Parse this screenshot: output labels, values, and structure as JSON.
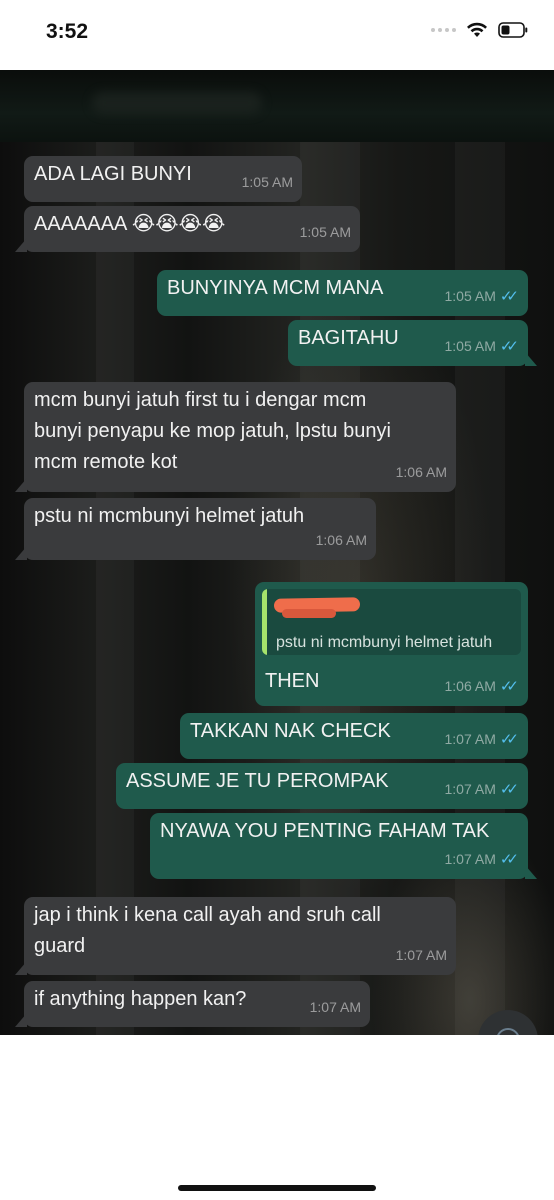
{
  "status_bar": {
    "time": "3:52"
  },
  "messages": [
    {
      "dir": "in",
      "text": "ADA LAGI BUNYI",
      "time": "1:05 AM"
    },
    {
      "dir": "in",
      "text": "AAAAAAA 😭😭😭😭",
      "time": "1:05 AM"
    },
    {
      "dir": "out",
      "text": "BUNYINYA MCM MANA",
      "time": "1:05 AM",
      "read": true
    },
    {
      "dir": "out",
      "text": "BAGITAHU",
      "time": "1:05 AM",
      "read": true
    },
    {
      "dir": "in",
      "text": "mcm bunyi jatuh first tu i dengar mcm\nbunyi penyapu ke mop jatuh, lpstu bunyi\nmcm remote kot",
      "time": "1:06 AM"
    },
    {
      "dir": "in",
      "text": "pstu ni mcmbunyi helmet jatuh",
      "time": "1:06 AM"
    },
    {
      "dir": "out",
      "text": "THEN",
      "time": "1:06 AM",
      "read": true,
      "reply_to": "pstu ni mcmbunyi helmet jatuh"
    },
    {
      "dir": "out",
      "text": "TAKKAN NAK CHECK",
      "time": "1:07 AM",
      "read": true
    },
    {
      "dir": "out",
      "text": "ASSUME JE TU PEROMPAK",
      "time": "1:07 AM",
      "read": true
    },
    {
      "dir": "out",
      "text": "NYAWA YOU PENTING FAHAM TAK",
      "time": "1:07 AM",
      "read": true
    },
    {
      "dir": "in",
      "text": "jap i think i kena call ayah and sruh call\nguard",
      "time": "1:07 AM"
    },
    {
      "dir": "in",
      "text": "if anything happen kan?",
      "time": "1:07 AM"
    }
  ],
  "icons": {
    "signal": "signal-dots-icon",
    "wifi": "wifi-icon",
    "battery": "battery-icon",
    "read_receipt": "double-check-icon",
    "scroll_down": "scroll-down-icon"
  },
  "colors": {
    "incoming_bubble": "#3a3b3d",
    "outgoing_bubble": "#1f5a4c",
    "read_tick": "#53bdeb",
    "reply_bar": "#a6e36c"
  }
}
